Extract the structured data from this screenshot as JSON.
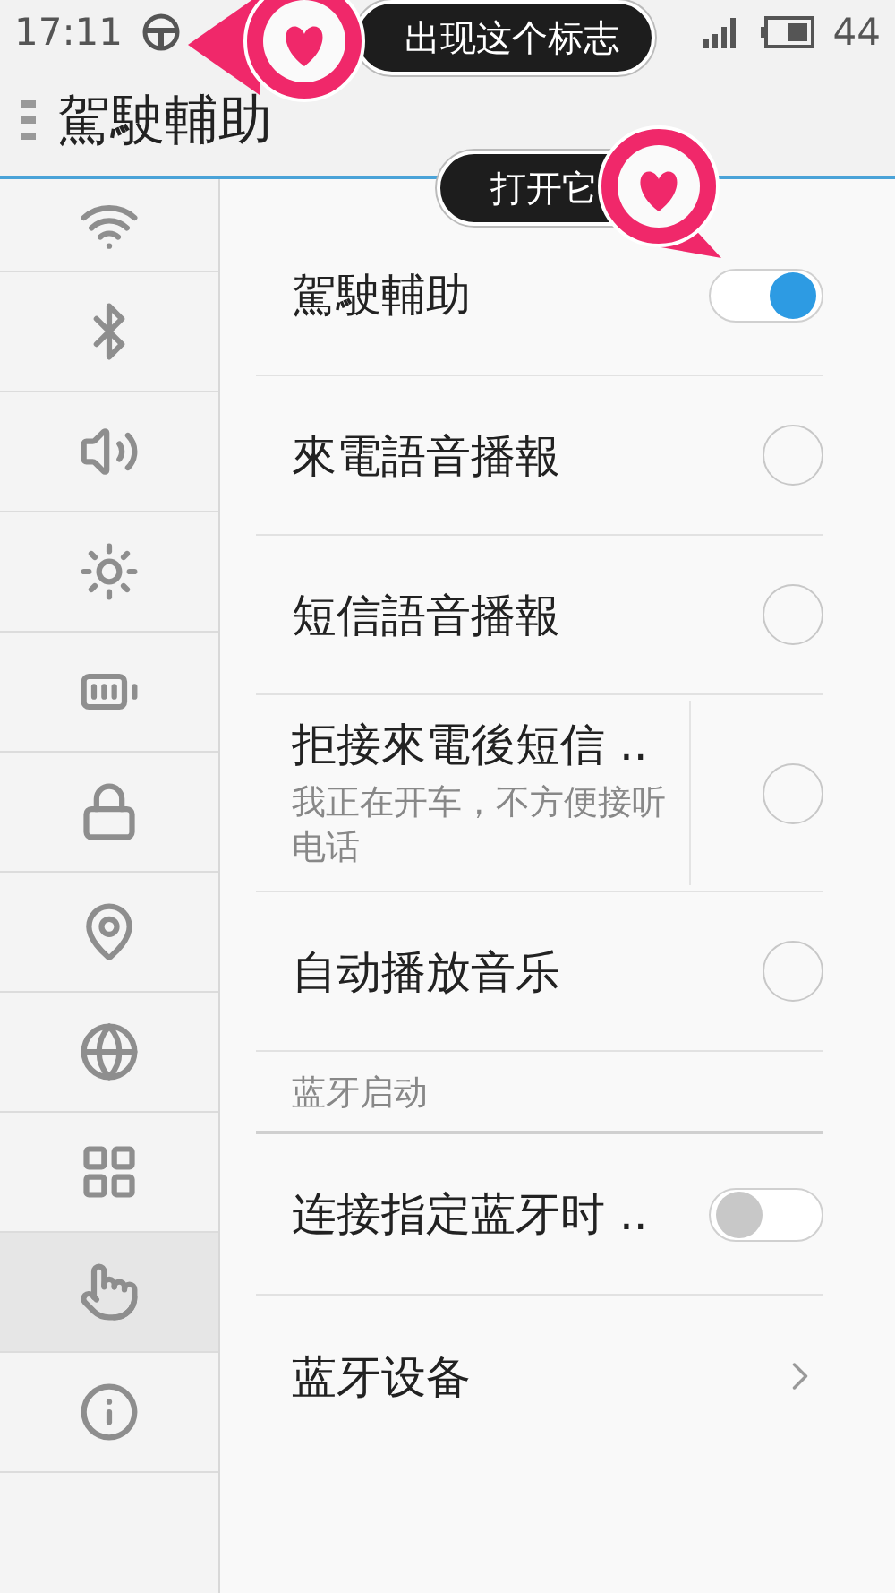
{
  "status_bar": {
    "time": "17:11",
    "battery": "44"
  },
  "toolbar": {
    "title": "駕駛輔助"
  },
  "sidebar": {
    "items": [
      {
        "kind": "wifi",
        "selected": false
      },
      {
        "kind": "bluetooth",
        "selected": false
      },
      {
        "kind": "volume",
        "selected": false
      },
      {
        "kind": "brightness",
        "selected": false
      },
      {
        "kind": "battery",
        "selected": false
      },
      {
        "kind": "lock",
        "selected": false
      },
      {
        "kind": "location",
        "selected": false
      },
      {
        "kind": "globe",
        "selected": false
      },
      {
        "kind": "apps",
        "selected": false
      },
      {
        "kind": "hand",
        "selected": true
      },
      {
        "kind": "info",
        "selected": false
      }
    ]
  },
  "settings": {
    "items": [
      {
        "kind": "switch",
        "title": "駕駛輔助",
        "on": true
      },
      {
        "kind": "check",
        "title": "來電語音播報",
        "checked": false
      },
      {
        "kind": "check",
        "title": "短信語音播報",
        "checked": false
      },
      {
        "kind": "check",
        "title": "拒接來電後短信 ..",
        "subtitle": "我正在开车，不方便接听电话",
        "checked": false
      },
      {
        "kind": "check",
        "title": "自动播放音乐",
        "checked": false
      },
      {
        "kind": "header",
        "title": "蓝牙启动"
      },
      {
        "kind": "switch",
        "title": "连接指定蓝牙时 ..",
        "on": false
      },
      {
        "kind": "link",
        "title": "蓝牙设备"
      }
    ]
  },
  "annotations": [
    {
      "text": "出现这个标志"
    },
    {
      "text": "打开它"
    }
  ]
}
